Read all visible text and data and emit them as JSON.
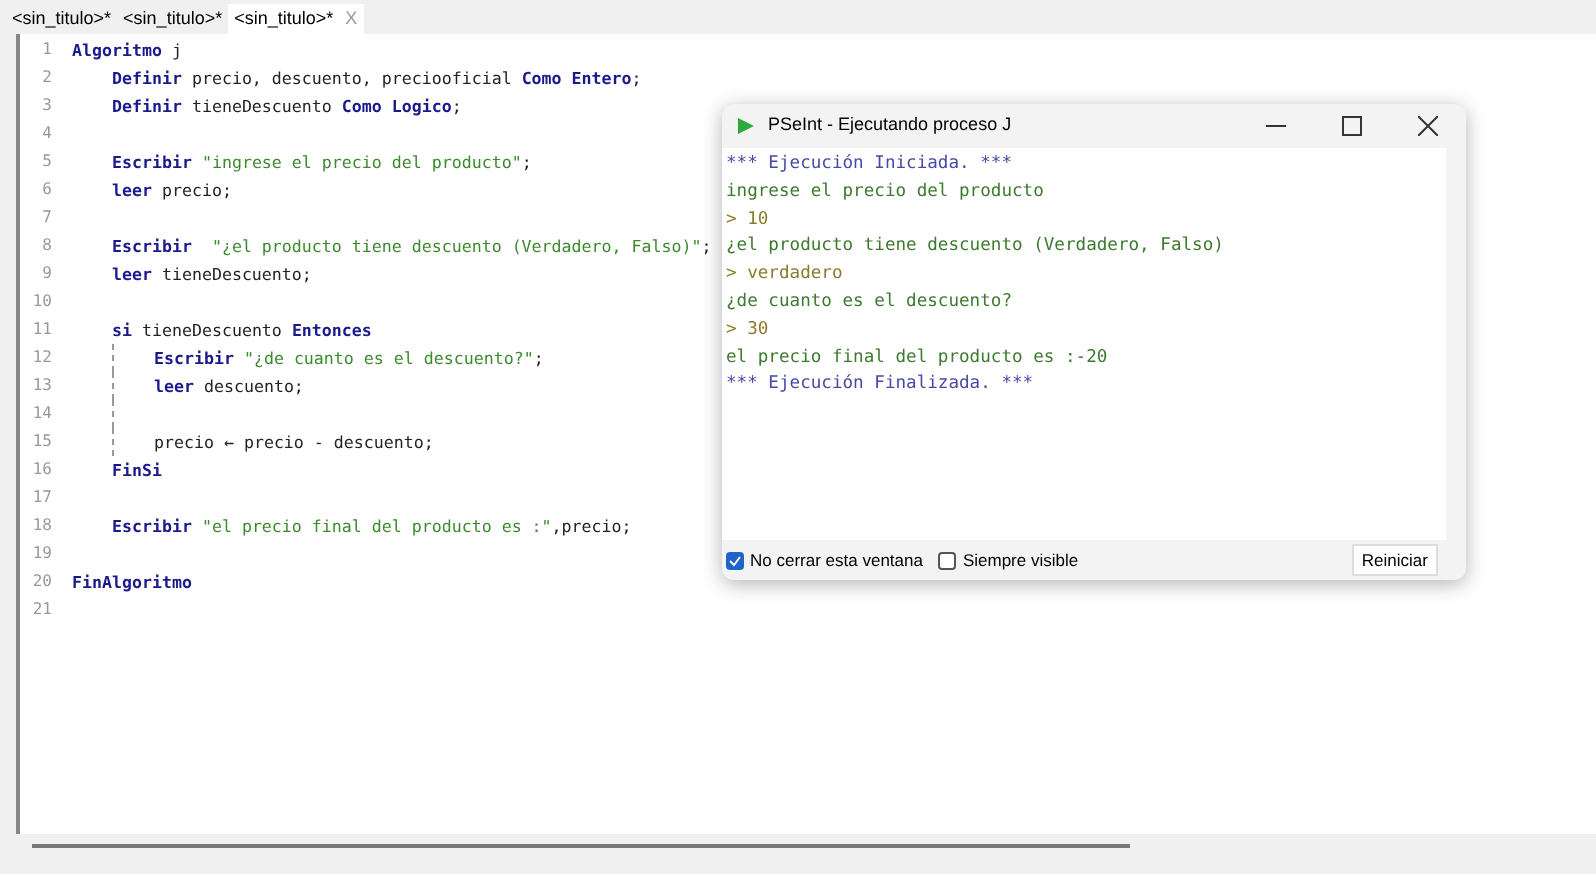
{
  "tabs": [
    {
      "label": "<sin_titulo>*",
      "selected": false
    },
    {
      "label": "<sin_titulo>*",
      "selected": false
    },
    {
      "label": "<sin_titulo>*",
      "selected": true,
      "close": "X"
    }
  ],
  "code_lines": [
    {
      "number": "1",
      "indented": false,
      "guide": false,
      "segments": [
        {
          "kind": "keyword",
          "text": "Algoritmo"
        },
        {
          "kind": "plain",
          "text": " j"
        }
      ]
    },
    {
      "number": "2",
      "indented": true,
      "guide": false,
      "segments": [
        {
          "kind": "keyword",
          "text": "Definir"
        },
        {
          "kind": "plain",
          "text": " precio, descuento, preciooficial "
        },
        {
          "kind": "keyword",
          "text": "Como Entero"
        },
        {
          "kind": "plain",
          "text": ";"
        }
      ]
    },
    {
      "number": "3",
      "indented": true,
      "guide": false,
      "segments": [
        {
          "kind": "keyword",
          "text": "Definir"
        },
        {
          "kind": "plain",
          "text": " tieneDescuento "
        },
        {
          "kind": "keyword",
          "text": "Como Logico"
        },
        {
          "kind": "plain",
          "text": ";"
        }
      ]
    },
    {
      "number": "4"
    },
    {
      "number": "5",
      "indented": true,
      "guide": false,
      "segments": [
        {
          "kind": "keyword",
          "text": "Escribir"
        },
        {
          "kind": "string",
          "text": " \"ingrese el precio del producto\""
        },
        {
          "kind": "plain",
          "text": ";"
        }
      ]
    },
    {
      "number": "6",
      "indented": true,
      "guide": false,
      "segments": [
        {
          "kind": "keyword",
          "text": "leer"
        },
        {
          "kind": "plain",
          "text": " precio;"
        }
      ]
    },
    {
      "number": "7"
    },
    {
      "number": "8",
      "indented": true,
      "guide": false,
      "segments": [
        {
          "kind": "keyword",
          "text": "Escribir"
        },
        {
          "kind": "string",
          "text": "  \"¿el producto tiene descuento (Verdadero, Falso)\""
        },
        {
          "kind": "plain",
          "text": ";"
        }
      ]
    },
    {
      "number": "9",
      "indented": true,
      "guide": false,
      "segments": [
        {
          "kind": "keyword",
          "text": "leer"
        },
        {
          "kind": "plain",
          "text": " tieneDescuento;"
        }
      ]
    },
    {
      "number": "10"
    },
    {
      "number": "11",
      "indented": true,
      "guide": false,
      "segments": [
        {
          "kind": "keyword",
          "text": "si"
        },
        {
          "kind": "plain",
          "text": " tieneDescuento "
        },
        {
          "kind": "keyword",
          "text": "Entonces"
        }
      ]
    },
    {
      "number": "12",
      "indented": true,
      "guide": true,
      "segments": [
        {
          "kind": "keyword",
          "text": "Escribir"
        },
        {
          "kind": "string",
          "text": " \"¿de cuanto es el descuento?\""
        },
        {
          "kind": "plain",
          "text": ";"
        }
      ]
    },
    {
      "number": "13",
      "indented": true,
      "guide": true,
      "segments": [
        {
          "kind": "keyword",
          "text": "leer"
        },
        {
          "kind": "plain",
          "text": " descuento;"
        }
      ]
    },
    {
      "number": "14",
      "guide": true
    },
    {
      "number": "15",
      "indented": true,
      "guide": true,
      "segments": [
        {
          "kind": "plain",
          "text": "precio ← precio - descuento;"
        }
      ]
    },
    {
      "number": "16",
      "indented": true,
      "guide": false,
      "segments": [
        {
          "kind": "keyword",
          "text": "FinSi"
        }
      ]
    },
    {
      "number": "17"
    },
    {
      "number": "18",
      "indented": true,
      "guide": false,
      "segments": [
        {
          "kind": "keyword",
          "text": "Escribir"
        },
        {
          "kind": "string",
          "text": " \"el precio final del producto es :\""
        },
        {
          "kind": "plain",
          "text": ",precio;"
        }
      ]
    },
    {
      "number": "19"
    },
    {
      "number": "20",
      "indented": false,
      "guide": false,
      "segments": [
        {
          "kind": "keyword",
          "text": "FinAlgoritmo"
        }
      ]
    },
    {
      "number": "21"
    }
  ],
  "console": {
    "title": "PSeInt - Ejecutando proceso J",
    "lines": [
      {
        "kind": "banner",
        "text": "*** Ejecución Iniciada. ***"
      },
      {
        "kind": "output",
        "text": "ingrese el precio del producto"
      },
      {
        "kind": "input",
        "text": "> 10"
      },
      {
        "kind": "output",
        "text": "¿el producto tiene descuento (Verdadero, Falso)"
      },
      {
        "kind": "input",
        "text": "> verdadero"
      },
      {
        "kind": "output",
        "text": "¿de cuanto es el descuento?"
      },
      {
        "kind": "input",
        "text": "> 30"
      },
      {
        "kind": "output",
        "text": "el precio final del producto es :-20"
      },
      {
        "kind": "banner",
        "text": "*** Ejecución Finalizada. ***"
      }
    ],
    "options": [
      {
        "label": "No cerrar esta ventana",
        "checked": true
      },
      {
        "label": "Siempre visible",
        "checked": false
      }
    ],
    "button": "Reiniciar"
  }
}
